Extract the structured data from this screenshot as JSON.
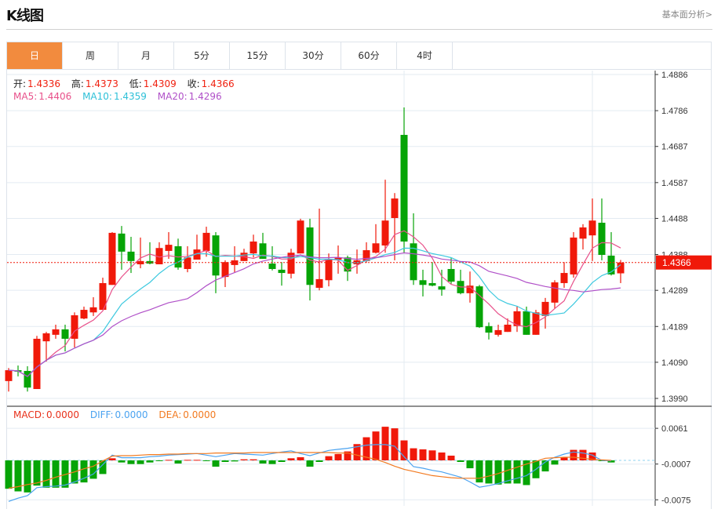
{
  "header": {
    "title": "K线图",
    "link": "基本面分析>"
  },
  "tabs": [
    {
      "label": "日",
      "active": true
    },
    {
      "label": "周"
    },
    {
      "label": "月"
    },
    {
      "label": "5分"
    },
    {
      "label": "15分"
    },
    {
      "label": "30分"
    },
    {
      "label": "60分"
    },
    {
      "label": "4时"
    }
  ],
  "ohlc_info": {
    "open_label": "开:",
    "open": "1.4336",
    "high_label": "高:",
    "high": "1.4373",
    "low_label": "低:",
    "low": "1.4309",
    "close_label": "收:",
    "close": "1.4366"
  },
  "ma_info": {
    "ma5_label": "MA5:",
    "ma5": "1.4406",
    "ma10_label": "MA10:",
    "ma10": "1.4359",
    "ma20_label": "MA20:",
    "ma20": "1.4296"
  },
  "macd_info": {
    "macd_label": "MACD:",
    "macd": "0.0000",
    "diff_label": "DIFF:",
    "diff": "0.0000",
    "dea_label": "DEA:",
    "dea": "0.0000"
  },
  "colors": {
    "up": "#f0190a",
    "down": "#06a406",
    "ma5": "#e8508a",
    "ma10": "#3ec9df",
    "ma20": "#b050c8",
    "diff": "#4ba3f0",
    "dea": "#f27a20",
    "active_tab": "#f28b3e",
    "grid": "#e3ebf2"
  },
  "chart_data": [
    {
      "type": "candlestick",
      "current_price": "1.4366",
      "y_ticks": [
        "1.4886",
        "1.4786",
        "1.4687",
        "1.4587",
        "1.4488",
        "1.4388",
        "1.4289",
        "1.4189",
        "1.4090",
        "1.3990"
      ],
      "ylim": [
        1.399,
        1.4886
      ],
      "grid": true,
      "ma_periods": [
        5,
        10,
        20
      ],
      "ohlc": [
        [
          1.4038,
          1.4074,
          1.4009,
          1.4068
        ],
        [
          1.4068,
          1.4081,
          1.4051,
          1.4064
        ],
        [
          1.4066,
          1.4079,
          1.4009,
          1.402
        ],
        [
          1.4016,
          1.4163,
          1.4016,
          1.4155
        ],
        [
          1.4148,
          1.4174,
          1.4092,
          1.417
        ],
        [
          1.4166,
          1.4194,
          1.4155,
          1.4181
        ],
        [
          1.4181,
          1.4194,
          1.412,
          1.4155
        ],
        [
          1.4155,
          1.4228,
          1.4131,
          1.422
        ],
        [
          1.4211,
          1.4244,
          1.4209,
          1.4235
        ],
        [
          1.4228,
          1.427,
          1.4218,
          1.4242
        ],
        [
          1.4235,
          1.4324,
          1.4235,
          1.4309
        ],
        [
          1.4304,
          1.445,
          1.4304,
          1.4448
        ],
        [
          1.4446,
          1.4467,
          1.4346,
          1.4396
        ],
        [
          1.4396,
          1.4437,
          1.4337,
          1.437
        ],
        [
          1.4361,
          1.4435,
          1.435,
          1.437
        ],
        [
          1.437,
          1.4422,
          1.4361,
          1.4363
        ],
        [
          1.4361,
          1.4422,
          1.4361,
          1.4406
        ],
        [
          1.4398,
          1.445,
          1.4376,
          1.4415
        ],
        [
          1.4411,
          1.4432,
          1.4346,
          1.4352
        ],
        [
          1.4348,
          1.4411,
          1.4339,
          1.438
        ],
        [
          1.4374,
          1.4443,
          1.4374,
          1.4402
        ],
        [
          1.4398,
          1.4465,
          1.4382,
          1.4448
        ],
        [
          1.4441,
          1.445,
          1.4281,
          1.433
        ],
        [
          1.4326,
          1.4372,
          1.4298,
          1.4367
        ],
        [
          1.4359,
          1.4411,
          1.4339,
          1.4372
        ],
        [
          1.437,
          1.4404,
          1.437,
          1.4393
        ],
        [
          1.4391,
          1.4443,
          1.438,
          1.4424
        ],
        [
          1.4419,
          1.4448,
          1.4376,
          1.4376
        ],
        [
          1.4363,
          1.4411,
          1.4344,
          1.4348
        ],
        [
          1.4346,
          1.4367,
          1.4302,
          1.4337
        ],
        [
          1.4335,
          1.4404,
          1.4322,
          1.4393
        ],
        [
          1.4391,
          1.4487,
          1.4391,
          1.4482
        ],
        [
          1.4463,
          1.4487,
          1.4261,
          1.4304
        ],
        [
          1.4296,
          1.4515,
          1.4289,
          1.432
        ],
        [
          1.4317,
          1.4391,
          1.43,
          1.4376
        ],
        [
          1.4374,
          1.4413,
          1.4335,
          1.438
        ],
        [
          1.438,
          1.4385,
          1.4315,
          1.4341
        ],
        [
          1.4361,
          1.4402,
          1.4335,
          1.4372
        ],
        [
          1.437,
          1.4422,
          1.4365,
          1.44
        ],
        [
          1.4393,
          1.4472,
          1.4391,
          1.4419
        ],
        [
          1.4413,
          1.4595,
          1.4393,
          1.4482
        ],
        [
          1.4489,
          1.4558,
          1.4372,
          1.4543
        ],
        [
          1.4719,
          1.4795,
          1.4391,
          1.4424
        ],
        [
          1.4419,
          1.4502,
          1.4304,
          1.4317
        ],
        [
          1.4317,
          1.4346,
          1.4272,
          1.4304
        ],
        [
          1.4309,
          1.4367,
          1.43,
          1.4302
        ],
        [
          1.43,
          1.4346,
          1.4274,
          1.4291
        ],
        [
          1.4348,
          1.4378,
          1.4307,
          1.4313
        ],
        [
          1.4315,
          1.4346,
          1.4278,
          1.4281
        ],
        [
          1.4281,
          1.4341,
          1.4255,
          1.4302
        ],
        [
          1.43,
          1.4304,
          1.4185,
          1.4187
        ],
        [
          1.419,
          1.42,
          1.4153,
          1.4172
        ],
        [
          1.4166,
          1.4194,
          1.4161,
          1.4179
        ],
        [
          1.4174,
          1.4211,
          1.4174,
          1.4194
        ],
        [
          1.419,
          1.4244,
          1.4174,
          1.4231
        ],
        [
          1.4231,
          1.4244,
          1.4166,
          1.4166
        ],
        [
          1.4166,
          1.4235,
          1.4166,
          1.4228
        ],
        [
          1.4218,
          1.4268,
          1.4183,
          1.4257
        ],
        [
          1.4255,
          1.4317,
          1.4239,
          1.4311
        ],
        [
          1.4309,
          1.4367,
          1.4296,
          1.4337
        ],
        [
          1.4333,
          1.445,
          1.4324,
          1.4435
        ],
        [
          1.4432,
          1.4472,
          1.4402,
          1.4463
        ],
        [
          1.4441,
          1.4543,
          1.437,
          1.4482
        ],
        [
          1.4476,
          1.4543,
          1.4372,
          1.4387
        ],
        [
          1.4385,
          1.445,
          1.433,
          1.4333
        ],
        [
          1.4336,
          1.4373,
          1.4309,
          1.4366
        ]
      ]
    },
    {
      "type": "bar",
      "name": "MACD",
      "y_ticks": [
        "0.0061",
        "-0.0007",
        "-0.0075"
      ],
      "ylim": [
        -0.0085,
        0.0085
      ],
      "macd": [
        -0.0054,
        -0.0059,
        -0.0061,
        -0.0048,
        -0.0052,
        -0.0052,
        -0.0052,
        -0.0044,
        -0.0042,
        -0.0035,
        -0.0026,
        0.0004,
        -0.0004,
        -0.0007,
        -0.0007,
        -0.0004,
        -0.0001,
        0.0001,
        -0.0006,
        0.0001,
        0.0001,
        -0.0001,
        -0.0012,
        -0.0003,
        -0.0002,
        0.0002,
        0.0002,
        -0.0006,
        -0.0007,
        -0.0003,
        0.0004,
        0.0006,
        -0.0012,
        -0.0003,
        0.0008,
        0.0012,
        0.0017,
        0.0031,
        0.0044,
        0.0055,
        0.0064,
        0.0061,
        0.0038,
        0.0023,
        0.0021,
        0.0019,
        0.0015,
        0.0009,
        -0.0003,
        -0.0015,
        -0.0042,
        -0.0044,
        -0.0046,
        -0.0044,
        -0.0044,
        -0.0047,
        -0.0034,
        -0.0021,
        -0.0008,
        0.0006,
        0.002,
        0.002,
        0.0015,
        -0.0001,
        -0.0004,
        0
      ],
      "diff": [
        -0.0078,
        -0.0072,
        -0.0067,
        -0.0052,
        -0.005,
        -0.0049,
        -0.0047,
        -0.0041,
        -0.0034,
        -0.0026,
        -0.0008,
        0.001,
        0.0005,
        0.0005,
        0.0005,
        0.0007,
        0.0008,
        0.001,
        0.0011,
        0.0012,
        0.0013,
        0.001,
        0.0007,
        0.001,
        0.0013,
        0.0012,
        0.0011,
        0.001,
        0.0013,
        0.0016,
        0.0018,
        0.0013,
        0.0009,
        0.0014,
        0.0019,
        0.0021,
        0.0023,
        0.0026,
        0.0029,
        0.003,
        0.003,
        0.0027,
        0.0007,
        -0.0012,
        -0.0015,
        -0.0019,
        -0.0022,
        -0.0027,
        -0.0032,
        -0.0041,
        -0.0051,
        -0.0048,
        -0.0044,
        -0.0039,
        -0.0034,
        -0.0029,
        -0.0017,
        -0.0003,
        0.0006,
        0.0012,
        0.0016,
        0.0014,
        0.001,
        0.0,
        -0.0001
      ],
      "dea": [
        -0.0053,
        -0.005,
        -0.0046,
        -0.0043,
        -0.0038,
        -0.0032,
        -0.0027,
        -0.0022,
        -0.0016,
        -0.0011,
        -0.0001,
        0.0008,
        0.0009,
        0.0009,
        0.001,
        0.0011,
        0.0011,
        0.0012,
        0.0012,
        0.0013,
        0.0013,
        0.0013,
        0.0014,
        0.0014,
        0.0014,
        0.0014,
        0.0015,
        0.0015,
        0.0015,
        0.0015,
        0.0015,
        0.0015,
        0.0015,
        0.0015,
        0.0015,
        0.0014,
        0.0014,
        0.001,
        0.0006,
        0.0002,
        -0.0004,
        -0.0011,
        -0.0017,
        -0.0021,
        -0.0025,
        -0.0029,
        -0.0031,
        -0.0033,
        -0.0034,
        -0.0034,
        -0.0034,
        -0.003,
        -0.0025,
        -0.0019,
        -0.0013,
        -0.0007,
        -0.0002,
        0.0004,
        0.0005,
        0.0006,
        0.0006,
        0.0004,
        0.0002,
        0.0001,
        0.0
      ]
    }
  ]
}
